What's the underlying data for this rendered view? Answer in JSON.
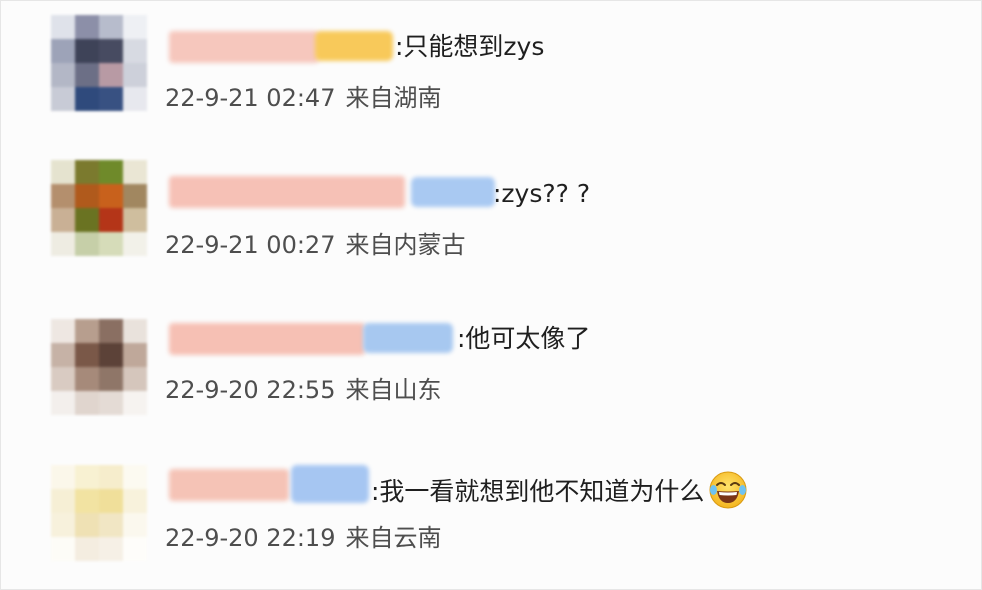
{
  "comments": [
    {
      "text": ":只能想到zys",
      "time": "22-9-21 02:47",
      "location": "来自湖南",
      "colors": {
        "name": "#f6c7bd",
        "handle": "#f8c95a"
      }
    },
    {
      "text": ":zys?? ?",
      "time": "22-9-21 00:27",
      "location": "来自内蒙古",
      "colors": {
        "name": "#f6c1b6",
        "handle": "#a9c9f2"
      }
    },
    {
      "text": ":他可太像了",
      "time": "22-9-20 22:55",
      "location": "来自山东",
      "colors": {
        "name": "#f6c0b4",
        "handle": "#a7c8f0"
      }
    },
    {
      "text": ":我一看就想到他不知道为什么",
      "emoji": "laughing-crying-emoji",
      "time": "22-9-20 22:19",
      "location": "来自云南",
      "colors": {
        "name": "#f5c3b6",
        "handle": "#a6c6f2"
      }
    }
  ]
}
